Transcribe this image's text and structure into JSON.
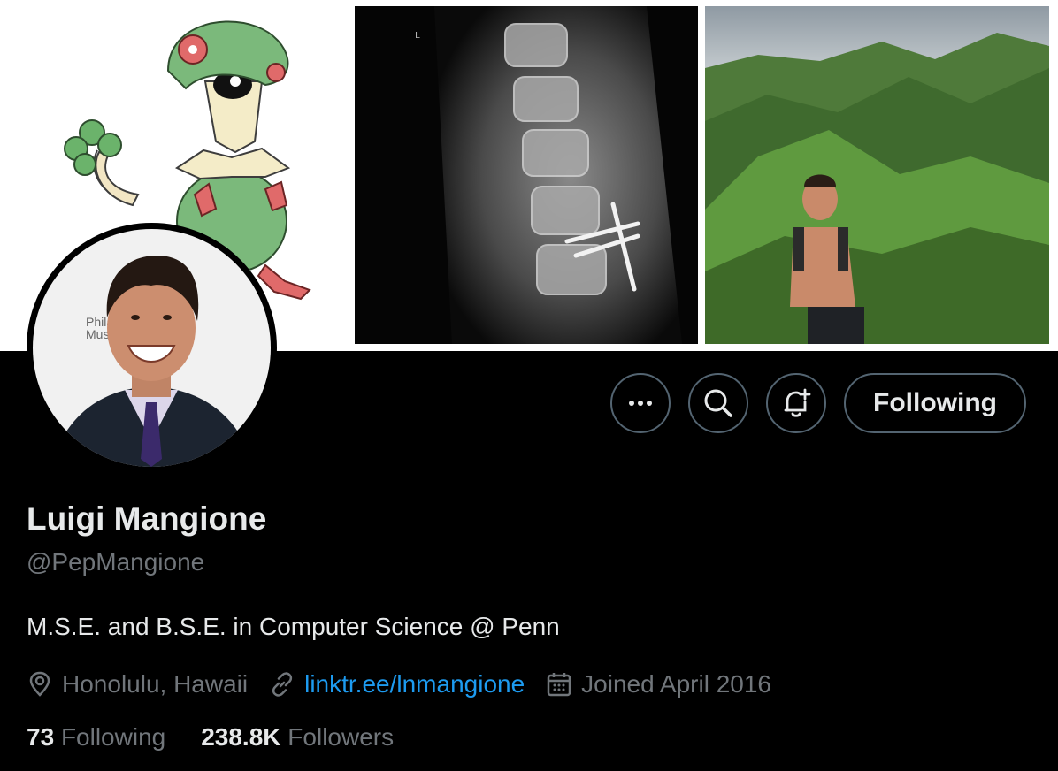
{
  "profile": {
    "display_name": "Luigi Mangione",
    "handle": "@PepMangione",
    "bio": "M.S.E. and B.S.E. in Computer Science @ Penn",
    "location": "Honolulu, Hawaii",
    "website": "linktr.ee/lnmangione",
    "joined": "Joined April 2016"
  },
  "stats": {
    "following_count": "73",
    "following_label": "Following",
    "followers_count": "238.8K",
    "followers_label": "Followers"
  },
  "actions": {
    "more_icon": "more-icon",
    "search_icon": "search-icon",
    "notify_icon": "bell-plus-icon",
    "following_label": "Following"
  },
  "avatar_backdrop_text": "Philad Muse",
  "xray_marker": "L",
  "colors": {
    "background": "#000000",
    "primary_text": "#e7e9ea",
    "secondary_text": "#71767b",
    "link": "#1d9bf0",
    "border": "#536471"
  }
}
